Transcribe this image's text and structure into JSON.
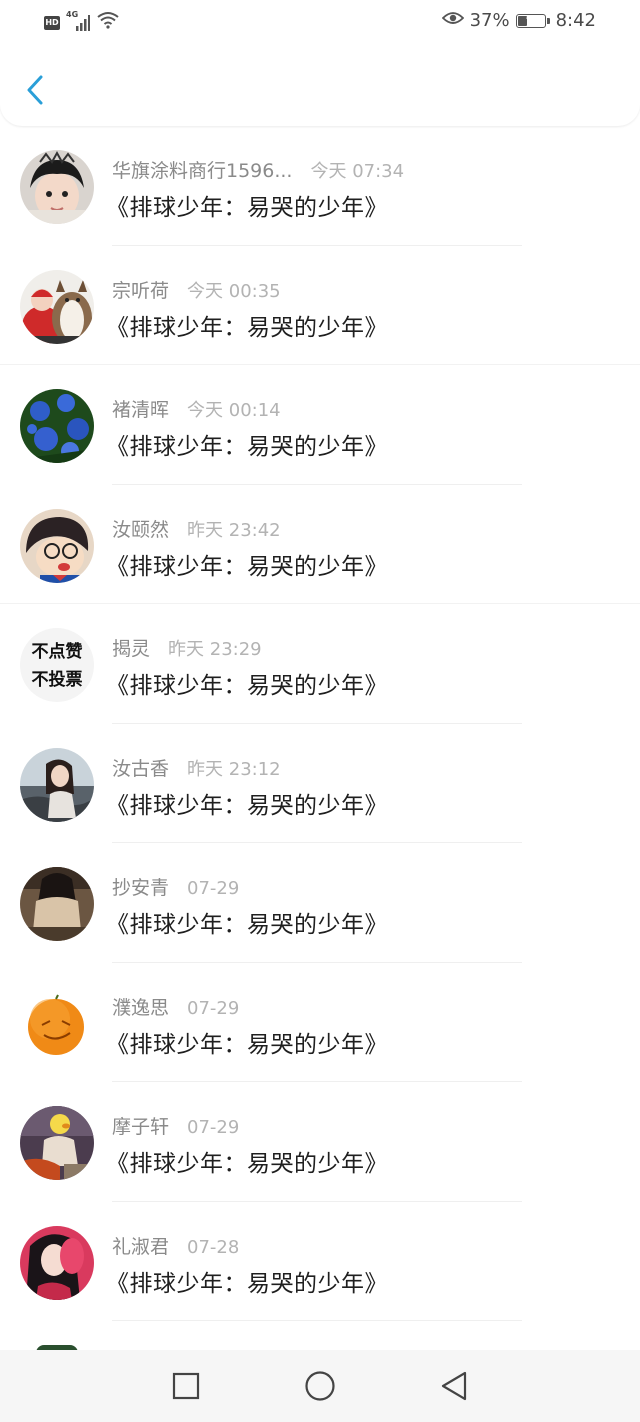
{
  "status_bar": {
    "network": "4G",
    "hd_label": "HD",
    "battery_percent": "37%",
    "battery_level": 0.37,
    "time": "8:42"
  },
  "header": {
    "back_icon": "chevron-left-icon",
    "accent_color": "#2a9fd8"
  },
  "list": [
    {
      "name": "华旗涂料商行1596...",
      "time": "今天 07:34",
      "message": "《排球少年：易哭的少年》",
      "avatar": "child-photo"
    },
    {
      "name": "宗听荷",
      "time": "今天 00:35",
      "message": "《排球少年：易哭的少年》",
      "avatar": "baby-and-dog-photo"
    },
    {
      "name": "褚清晖",
      "time": "今天 00:14",
      "message": "《排球少年：易哭的少年》",
      "avatar": "blue-flowers-photo"
    },
    {
      "name": "汝颐然",
      "time": "昨天 23:42",
      "message": "《排球少年：易哭的少年》",
      "avatar": "cartoon-detective"
    },
    {
      "name": "揭灵",
      "time": "昨天 23:29",
      "message": "《排球少年：易哭的少年》",
      "avatar": "text-avatar",
      "avatar_text": [
        "不点赞",
        "不投票"
      ]
    },
    {
      "name": "汝古香",
      "time": "昨天 23:12",
      "message": "《排球少年：易哭的少年》",
      "avatar": "girl-seaside-photo"
    },
    {
      "name": "抄安青",
      "time": "07-29",
      "message": "《排球少年：易哭的少年》",
      "avatar": "girl-back-photo"
    },
    {
      "name": "濮逸思",
      "time": "07-29",
      "message": "《排球少年：易哭的少年》",
      "avatar": "orange-face"
    },
    {
      "name": "摩子轩",
      "time": "07-29",
      "message": "《排球少年：易哭的少年》",
      "avatar": "girl-duck-mask-photo"
    },
    {
      "name": "礼淑君",
      "time": "07-28",
      "message": "《排球少年：易哭的少年》",
      "avatar": "girl-pink-photo"
    }
  ],
  "nav_bar": {
    "recent_icon": "square-icon",
    "home_icon": "circle-icon",
    "back_icon": "triangle-back-icon"
  }
}
